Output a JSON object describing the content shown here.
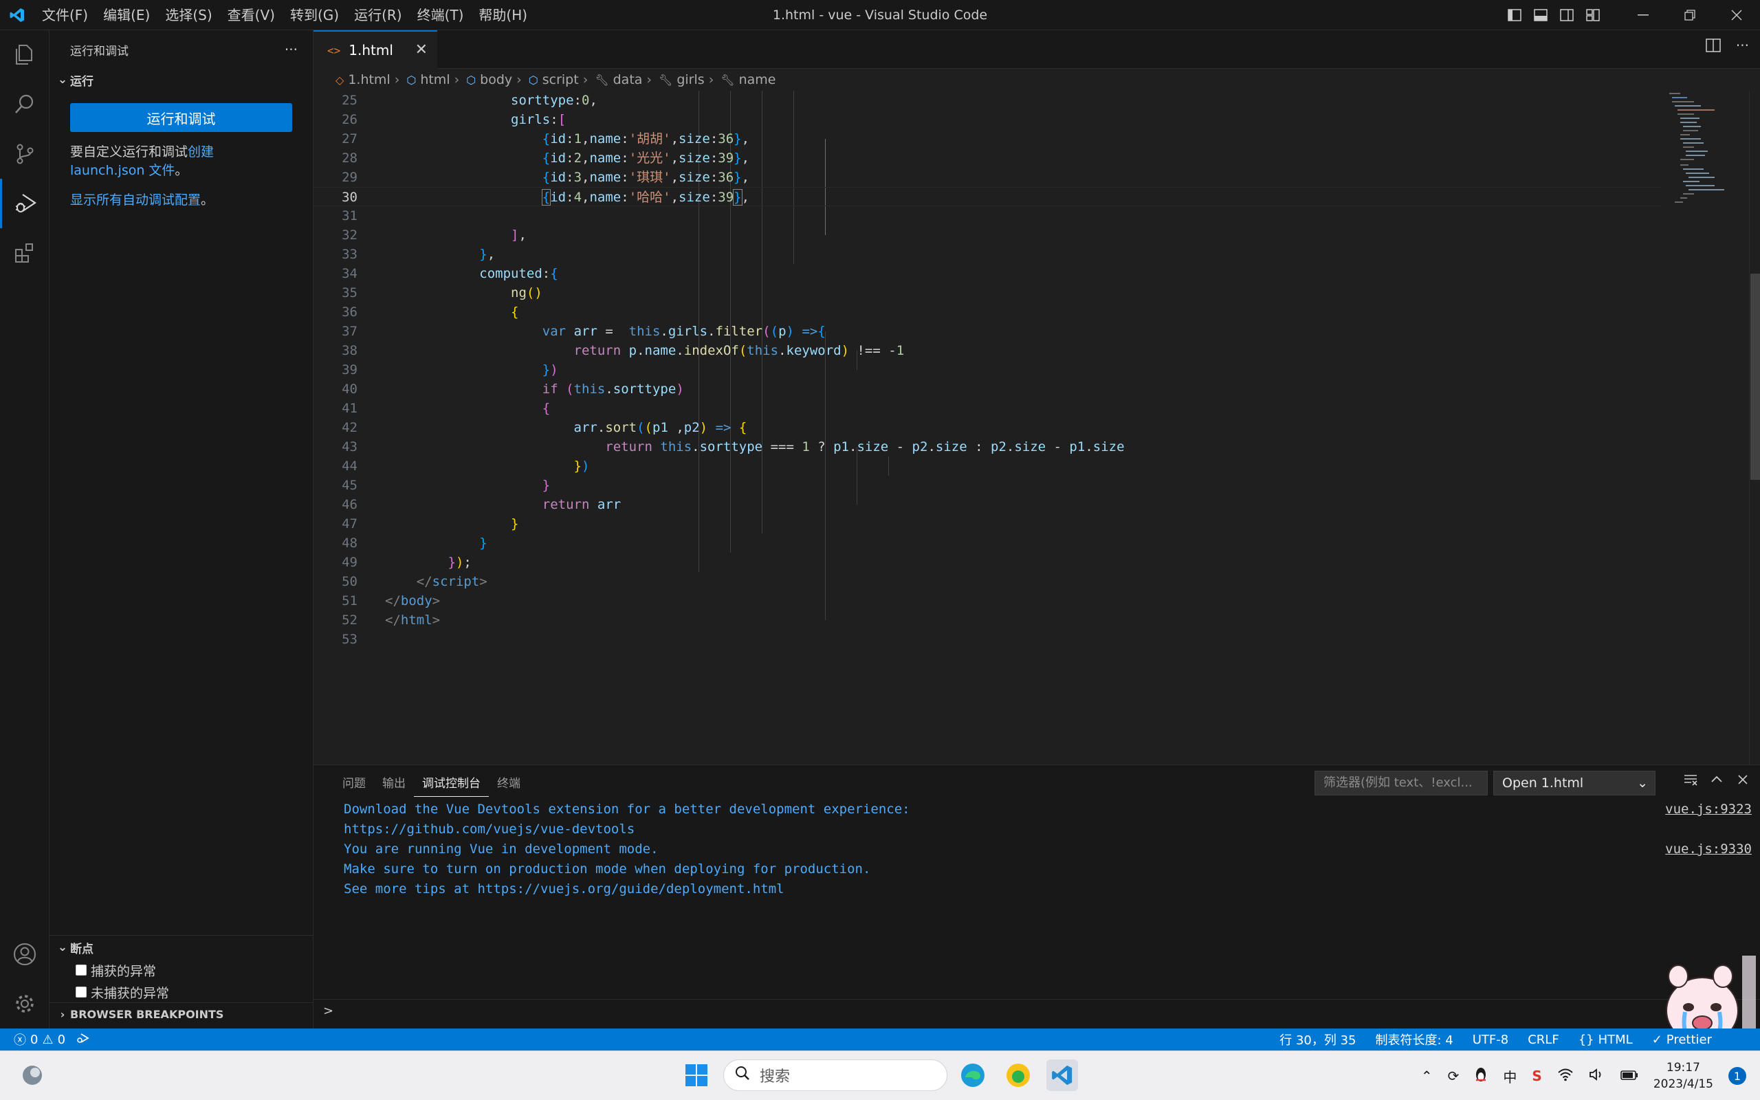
{
  "titlebar": {
    "menu": [
      "文件(F)",
      "编辑(E)",
      "选择(S)",
      "查看(V)",
      "转到(G)",
      "运行(R)",
      "终端(T)",
      "帮助(H)"
    ],
    "window_title": "1.html - vue - Visual Studio Code"
  },
  "sidebar": {
    "header": "运行和调试",
    "more": "···",
    "section_run": "运行",
    "run_button": "运行和调试",
    "customize_prefix": "要自定义运行和调试",
    "customize_link": "创建 launch.json 文件",
    "customize_suffix": "。",
    "show_all_link": "显示所有自动调试配置",
    "show_all_suffix": "。",
    "breakpoints_title": "断点",
    "bp_caught": "捕获的异常",
    "bp_uncaught": "未捕获的异常",
    "browser_bp": "BROWSER BREAKPOINTS"
  },
  "tab": {
    "icon": "<>",
    "label": "1.html",
    "close": "✕"
  },
  "breadcrumb": [
    "1.html",
    "html",
    "body",
    "script",
    "data",
    "girls",
    "name"
  ],
  "editor": {
    "current_line": 30,
    "line_numbers": [
      25,
      26,
      27,
      28,
      29,
      30,
      31,
      32,
      33,
      34,
      35,
      36,
      37,
      38,
      39,
      40,
      41,
      42,
      43,
      44,
      45,
      46,
      47,
      48,
      49,
      50,
      51,
      52,
      53
    ]
  },
  "panel": {
    "tabs": [
      "问题",
      "输出",
      "调试控制台",
      "终端"
    ],
    "active_tab": "调试控制台",
    "filter_placeholder": "筛选器(例如 text、!excl...",
    "session": "Open 1.html",
    "console": [
      {
        "text": "Download the Vue Devtools extension for a better development experience:",
        "src": "vue.js:9323"
      },
      {
        "text": "https://github.com/vuejs/vue-devtools",
        "src": ""
      },
      {
        "text": "You are running Vue in development mode.",
        "src": "vue.js:9330"
      },
      {
        "text": "Make sure to turn on production mode when deploying for production.",
        "src": ""
      },
      {
        "text": "See more tips at https://vuejs.org/guide/deployment.html",
        "src": ""
      }
    ],
    "prompt": ">"
  },
  "statusbar": {
    "errors": "0",
    "warnings": "0",
    "position": "行 30，列 35",
    "tab_size": "制表符长度: 4",
    "encoding": "UTF-8",
    "eol": "CRLF",
    "language": "HTML",
    "formatter": "Prettier"
  },
  "taskbar": {
    "search": "搜索",
    "ime": "中",
    "time": "19:17",
    "date": "2023/4/15",
    "notifications": "1"
  },
  "colors": {
    "accent": "#0078d4",
    "editor_bg": "#1f1f1f",
    "sidebar_bg": "#181818",
    "link": "#4daafc"
  }
}
